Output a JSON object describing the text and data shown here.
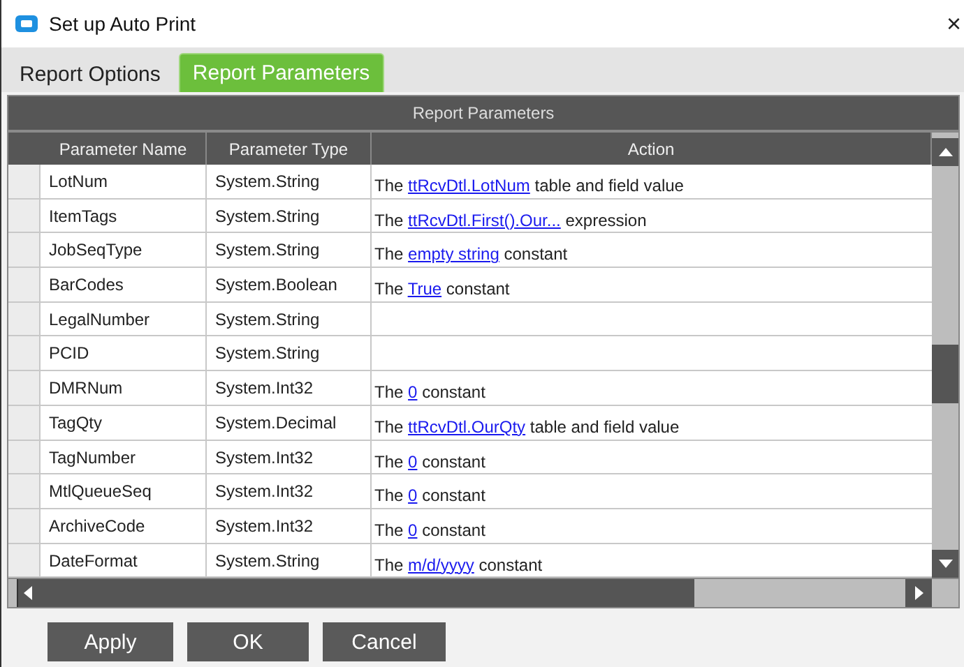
{
  "window": {
    "title": "Set up Auto Print",
    "close": "×"
  },
  "tabs": [
    {
      "label": "Report Options",
      "selected": false
    },
    {
      "label": "Report Parameters",
      "selected": true
    }
  ],
  "grid": {
    "caption": "Report Parameters",
    "columns": [
      "Parameter Name",
      "Parameter Type",
      "Action"
    ],
    "rows": [
      {
        "name": "LotNum",
        "type": "System.String",
        "action": {
          "prefix": "The",
          "link": "ttRcvDtl.LotNum",
          "suffix": "table and field value"
        }
      },
      {
        "name": "ItemTags",
        "type": "System.String",
        "action": {
          "prefix": "The",
          "link": "ttRcvDtl.First().Our...",
          "suffix": "expression"
        }
      },
      {
        "name": "JobSeqType",
        "type": "System.String",
        "action": {
          "prefix": "The",
          "link": "empty string",
          "suffix": "constant"
        }
      },
      {
        "name": "BarCodes",
        "type": "System.Boolean",
        "action": {
          "prefix": "The",
          "link": "True",
          "suffix": "constant"
        }
      },
      {
        "name": "LegalNumber",
        "type": "System.String"
      },
      {
        "name": "PCID",
        "type": "System.String"
      },
      {
        "name": "DMRNum",
        "type": "System.Int32",
        "action": {
          "prefix": "The",
          "link": "0",
          "suffix": "constant"
        }
      },
      {
        "name": "TagQty",
        "type": "System.Decimal",
        "action": {
          "prefix": "The",
          "link": "ttRcvDtl.OurQty",
          "suffix": "table and field value"
        }
      },
      {
        "name": "TagNumber",
        "type": "System.Int32",
        "action": {
          "prefix": "The",
          "link": "0",
          "suffix": "constant"
        }
      },
      {
        "name": "MtlQueueSeq",
        "type": "System.Int32",
        "action": {
          "prefix": "The",
          "link": "0",
          "suffix": "constant"
        }
      },
      {
        "name": "ArchiveCode",
        "type": "System.Int32",
        "action": {
          "prefix": "The",
          "link": "0",
          "suffix": "constant"
        }
      },
      {
        "name": "DateFormat",
        "type": "System.String",
        "action": {
          "prefix": "The",
          "link": "m/d/yyyy",
          "suffix": "constant"
        }
      }
    ]
  },
  "buttons": [
    "Apply",
    "OK",
    "Cancel"
  ]
}
